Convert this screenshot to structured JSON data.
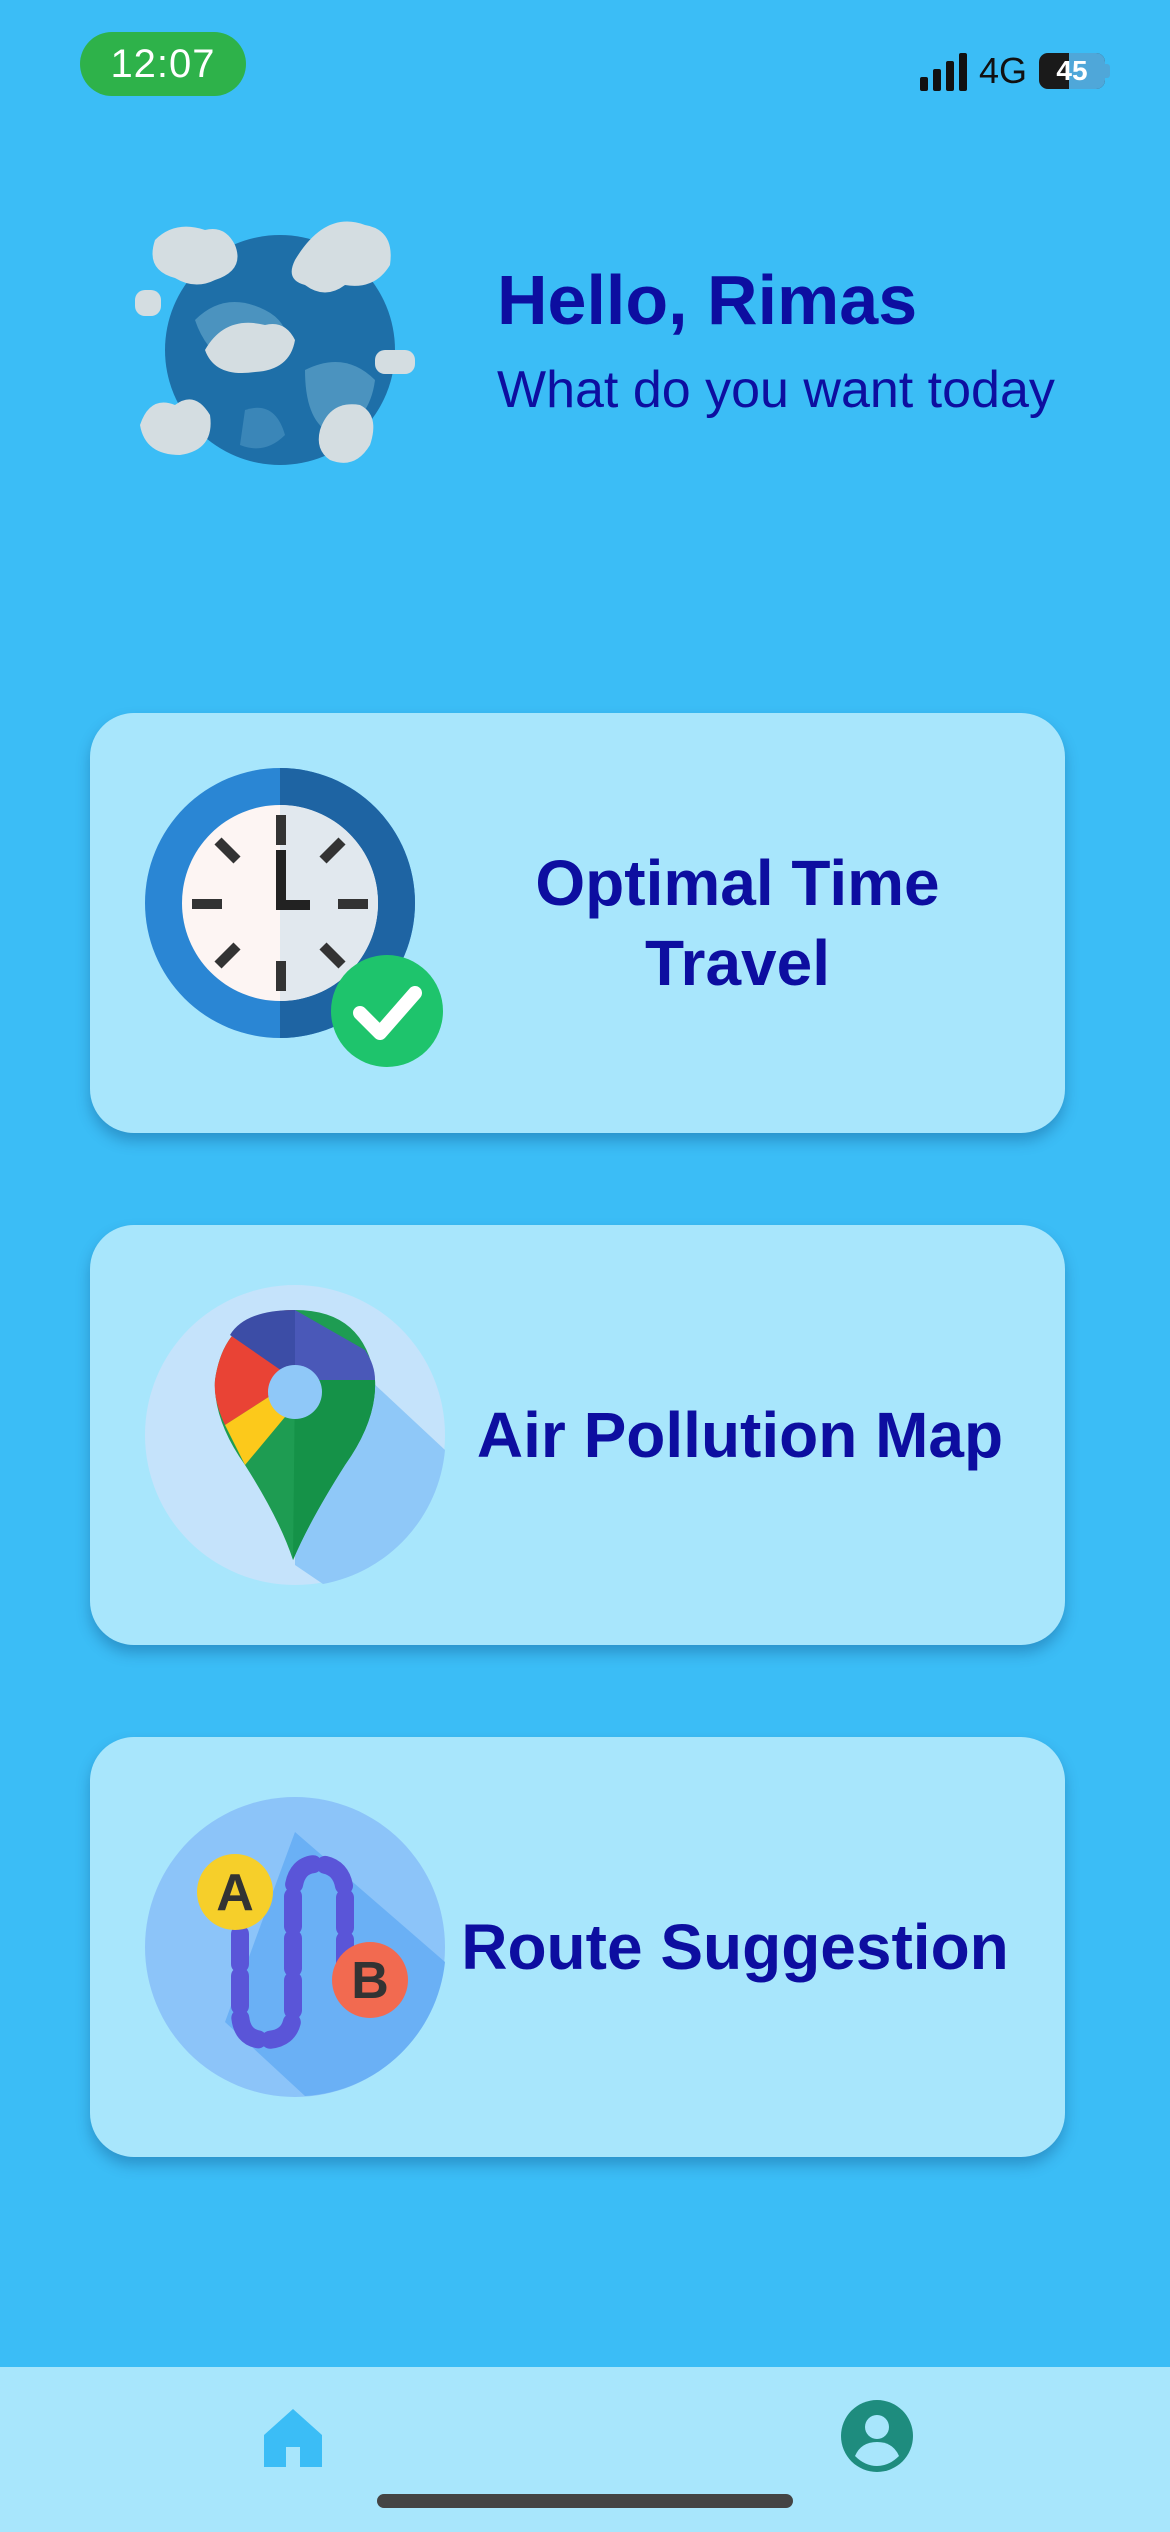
{
  "status_bar": {
    "time": "12:07",
    "network": "4G",
    "battery": "45"
  },
  "header": {
    "greeting": "Hello, Rimas",
    "subtitle": "What do you want today"
  },
  "cards": [
    {
      "label": "Optimal Time Travel",
      "icon": "clock-check-icon"
    },
    {
      "label": "Air Pollution Map",
      "icon": "map-pin-icon"
    },
    {
      "label": "Route Suggestion",
      "icon": "route-icon"
    }
  ],
  "route_icon_labels": {
    "start": "A",
    "end": "B"
  },
  "bottom_nav": [
    {
      "name": "home",
      "icon": "home-icon",
      "active": true
    },
    {
      "name": "profile",
      "icon": "profile-icon",
      "active": false
    }
  ],
  "colors": {
    "background": "#3BBDF6",
    "card": "#A8E6FC",
    "text": "#0D0EA0",
    "time_pill": "#2EB24A"
  }
}
